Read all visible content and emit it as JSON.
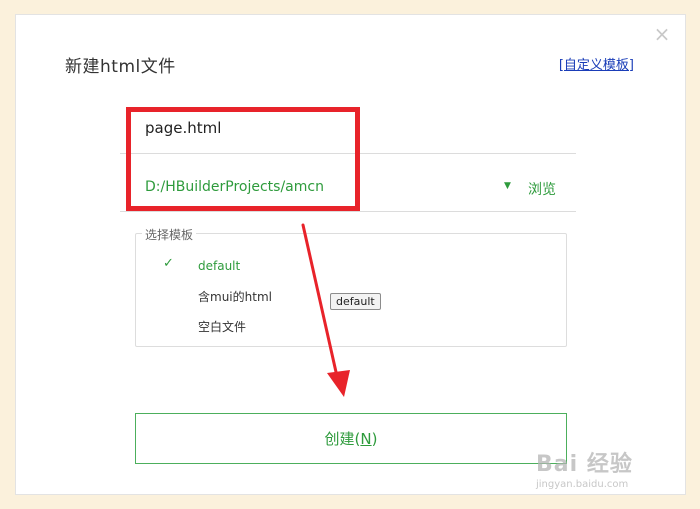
{
  "dialog": {
    "title": "新建html文件",
    "close_icon": "close-icon",
    "custom_template_link": "[自定义模板]"
  },
  "form": {
    "filename_value": "page.html",
    "path_value": "D:/HBuilderProjects/amcn",
    "dropdown_icon": "triangle-down-icon",
    "browse_label": "浏览"
  },
  "templates": {
    "legend": "选择模板",
    "items": [
      {
        "label": "default",
        "selected": true
      },
      {
        "label": "含mui的html",
        "selected": false
      },
      {
        "label": "空白文件",
        "selected": false
      }
    ],
    "tooltip": "default"
  },
  "create_button": {
    "label_prefix": "创建(",
    "mnemonic": "N",
    "label_suffix": ")"
  },
  "annotation": {
    "highlight_color": "#e8232a"
  },
  "watermark": {
    "brand": "Bai 经验",
    "sub": "jingyan.baidu.com"
  }
}
